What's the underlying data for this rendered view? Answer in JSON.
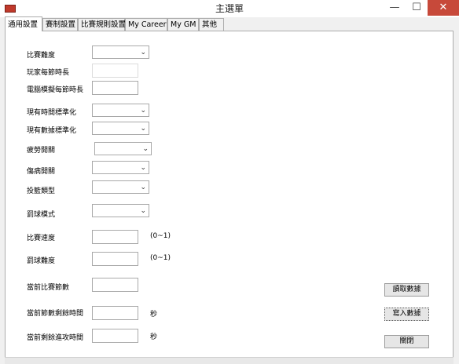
{
  "window": {
    "title": "主選單",
    "minimize": "—",
    "maximize": "☐",
    "close": "✕"
  },
  "tabs": [
    "通用設置",
    "賽制設置",
    "比賽規則設置",
    "My Career",
    "My GM",
    "其他"
  ],
  "active_tab": "通用設置",
  "form": {
    "difficulty_label": "比賽難度",
    "player_quarter_label": "玩家每節時長",
    "cpu_quarter_label": "電腦模擬每節時長",
    "realtime_std_label": "現有時間標準化",
    "data_std_label": "現有數據標準化",
    "fatigue_label": "疲勞開關",
    "injury_label": "傷病開關",
    "shot_type_label": "投籃類型",
    "foul_mode_label": "罰球模式",
    "game_speed_label": "比賽速度",
    "foul_difficulty_label": "罰球難度",
    "range_hint_1": "(0~1)",
    "range_hint_2": "(0~1)",
    "current_quarter_label": "當前比賽節數",
    "quarter_remaining_label": "當前節數剩餘時間",
    "shot_clock_label": "當前剩餘進攻時間",
    "seconds_unit_1": "秒",
    "seconds_unit_2": "秒"
  },
  "buttons": {
    "read": "讀取數據",
    "write": "寫入數據",
    "close": "關閉"
  },
  "icons": {
    "dropdown": "chevron-down-icon",
    "app": "app-icon"
  }
}
